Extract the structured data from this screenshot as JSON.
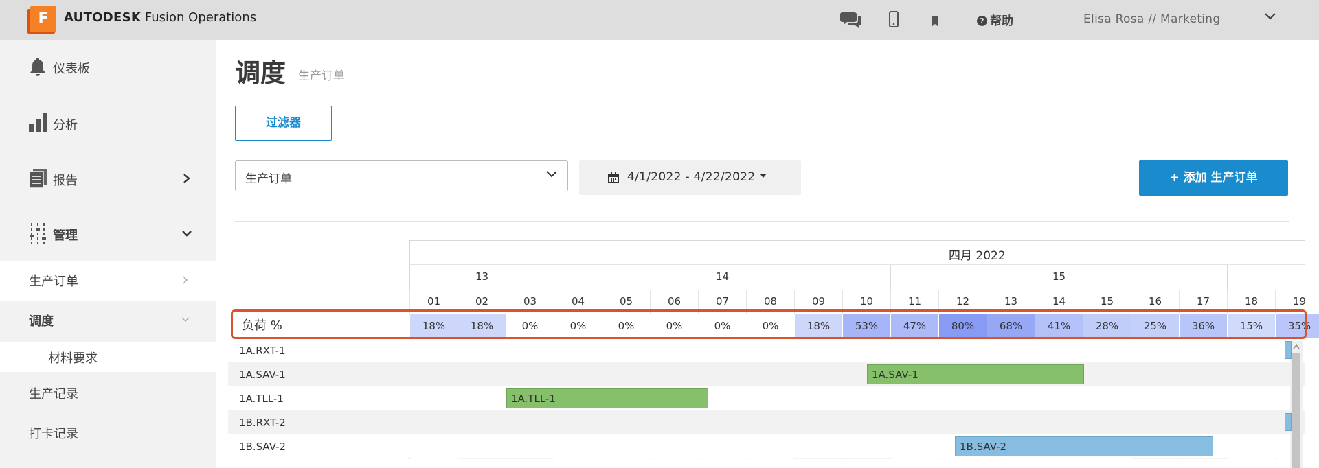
{
  "app": {
    "brand_bold": "AUTODESK",
    "brand_rest": " Fusion Operations",
    "logo_letter": "F",
    "help_label": "帮助",
    "user_label": "Elisa Rosa // Marketing"
  },
  "sidebar": {
    "items": [
      {
        "label": "仪表板",
        "icon": "bell-icon"
      },
      {
        "label": "分析",
        "icon": "bar-chart-icon"
      },
      {
        "label": "报告",
        "icon": "report-icon"
      },
      {
        "label": "管理",
        "icon": "sliders-icon"
      },
      {
        "label": "生产订单"
      },
      {
        "label": "调度"
      },
      {
        "label": "材料要求"
      },
      {
        "label": "生产记录"
      },
      {
        "label": "打卡记录"
      }
    ]
  },
  "page": {
    "title": "调度",
    "subtitle": "生产订单",
    "filter_label": "过滤器",
    "select_value": "生产订单",
    "date_range": "4/1/2022 - 4/22/2022",
    "add_button": "+ 添加 生产订单"
  },
  "gantt": {
    "month": "四月 2022",
    "weeks": [
      "13",
      "14",
      "15"
    ],
    "days": [
      "01",
      "02",
      "03",
      "04",
      "05",
      "06",
      "07",
      "08",
      "09",
      "10",
      "11",
      "12",
      "13",
      "14",
      "15",
      "16",
      "17",
      "18",
      "19"
    ],
    "load_label": "负荷 %",
    "load": [
      "18%",
      "18%",
      "0%",
      "0%",
      "0%",
      "0%",
      "0%",
      "0%",
      "18%",
      "53%",
      "47%",
      "80%",
      "68%",
      "41%",
      "28%",
      "25%",
      "36%",
      "15%",
      "35%"
    ],
    "load_values": [
      18,
      18,
      0,
      0,
      0,
      0,
      0,
      0,
      18,
      53,
      47,
      80,
      68,
      41,
      28,
      25,
      36,
      15,
      35
    ],
    "rows": [
      "1A.RXT-1",
      "1A.SAV-1",
      "1A.TLL-1",
      "1B.RXT-2",
      "1B.SAV-2"
    ],
    "bars": [
      {
        "label": "1A.SAV-1",
        "row": 1,
        "color": "green"
      },
      {
        "label": "1A.TLL-1",
        "row": 2,
        "color": "green"
      },
      {
        "label": "1B.SAV-2",
        "row": 4,
        "color": "blue"
      }
    ]
  },
  "colors": {
    "accent": "#1a8ccd",
    "bar_green": "#86c06b",
    "bar_blue": "#86bde0",
    "highlight": "#d9532c"
  }
}
